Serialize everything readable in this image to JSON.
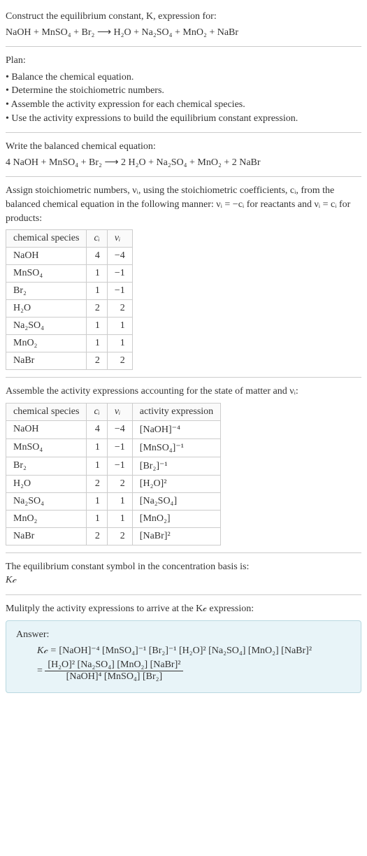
{
  "intro": {
    "prompt": "Construct the equilibrium constant, K, expression for:",
    "unbalanced": "NaOH + MnSO₄ + Br₂ ⟶ H₂O + Na₂SO₄ + MnO₂ + NaBr"
  },
  "plan": {
    "title": "Plan:",
    "items": [
      "• Balance the chemical equation.",
      "• Determine the stoichiometric numbers.",
      "• Assemble the activity expression for each chemical species.",
      "• Use the activity expressions to build the equilibrium constant expression."
    ]
  },
  "balanced_section": {
    "title": "Write the balanced chemical equation:",
    "equation": "4 NaOH + MnSO₄ + Br₂ ⟶ 2 H₂O + Na₂SO₄ + MnO₂ + 2 NaBr"
  },
  "stoich_section": {
    "text": "Assign stoichiometric numbers, νᵢ, using the stoichiometric coefficients, cᵢ, from the balanced chemical equation in the following manner: νᵢ = −cᵢ for reactants and νᵢ = cᵢ for products:",
    "headers": {
      "species": "chemical species",
      "ci": "cᵢ",
      "vi": "νᵢ"
    },
    "rows": [
      {
        "species": "NaOH",
        "ci": "4",
        "vi": "−4"
      },
      {
        "species": "MnSO₄",
        "ci": "1",
        "vi": "−1"
      },
      {
        "species": "Br₂",
        "ci": "1",
        "vi": "−1"
      },
      {
        "species": "H₂O",
        "ci": "2",
        "vi": "2"
      },
      {
        "species": "Na₂SO₄",
        "ci": "1",
        "vi": "1"
      },
      {
        "species": "MnO₂",
        "ci": "1",
        "vi": "1"
      },
      {
        "species": "NaBr",
        "ci": "2",
        "vi": "2"
      }
    ]
  },
  "activity_section": {
    "text": "Assemble the activity expressions accounting for the state of matter and νᵢ:",
    "headers": {
      "species": "chemical species",
      "ci": "cᵢ",
      "vi": "νᵢ",
      "act": "activity expression"
    },
    "rows": [
      {
        "species": "NaOH",
        "ci": "4",
        "vi": "−4",
        "act": "[NaOH]⁻⁴"
      },
      {
        "species": "MnSO₄",
        "ci": "1",
        "vi": "−1",
        "act": "[MnSO₄]⁻¹"
      },
      {
        "species": "Br₂",
        "ci": "1",
        "vi": "−1",
        "act": "[Br₂]⁻¹"
      },
      {
        "species": "H₂O",
        "ci": "2",
        "vi": "2",
        "act": "[H₂O]²"
      },
      {
        "species": "Na₂SO₄",
        "ci": "1",
        "vi": "1",
        "act": "[Na₂SO₄]"
      },
      {
        "species": "MnO₂",
        "ci": "1",
        "vi": "1",
        "act": "[MnO₂]"
      },
      {
        "species": "NaBr",
        "ci": "2",
        "vi": "2",
        "act": "[NaBr]²"
      }
    ]
  },
  "symbol_section": {
    "text": "The equilibrium constant symbol in the concentration basis is:",
    "symbol": "K𝒸"
  },
  "multiply_section": {
    "text": "Mulitply the activity expressions to arrive at the K𝒸 expression:"
  },
  "answer": {
    "label": "Answer:",
    "line1_lhs": "K𝒸 = ",
    "line1_rhs": "[NaOH]⁻⁴ [MnSO₄]⁻¹ [Br₂]⁻¹ [H₂O]² [Na₂SO₄] [MnO₂] [NaBr]²",
    "line2_eq": "= ",
    "frac_num": "[H₂O]² [Na₂SO₄] [MnO₂] [NaBr]²",
    "frac_den": "[NaOH]⁴ [MnSO₄] [Br₂]"
  }
}
